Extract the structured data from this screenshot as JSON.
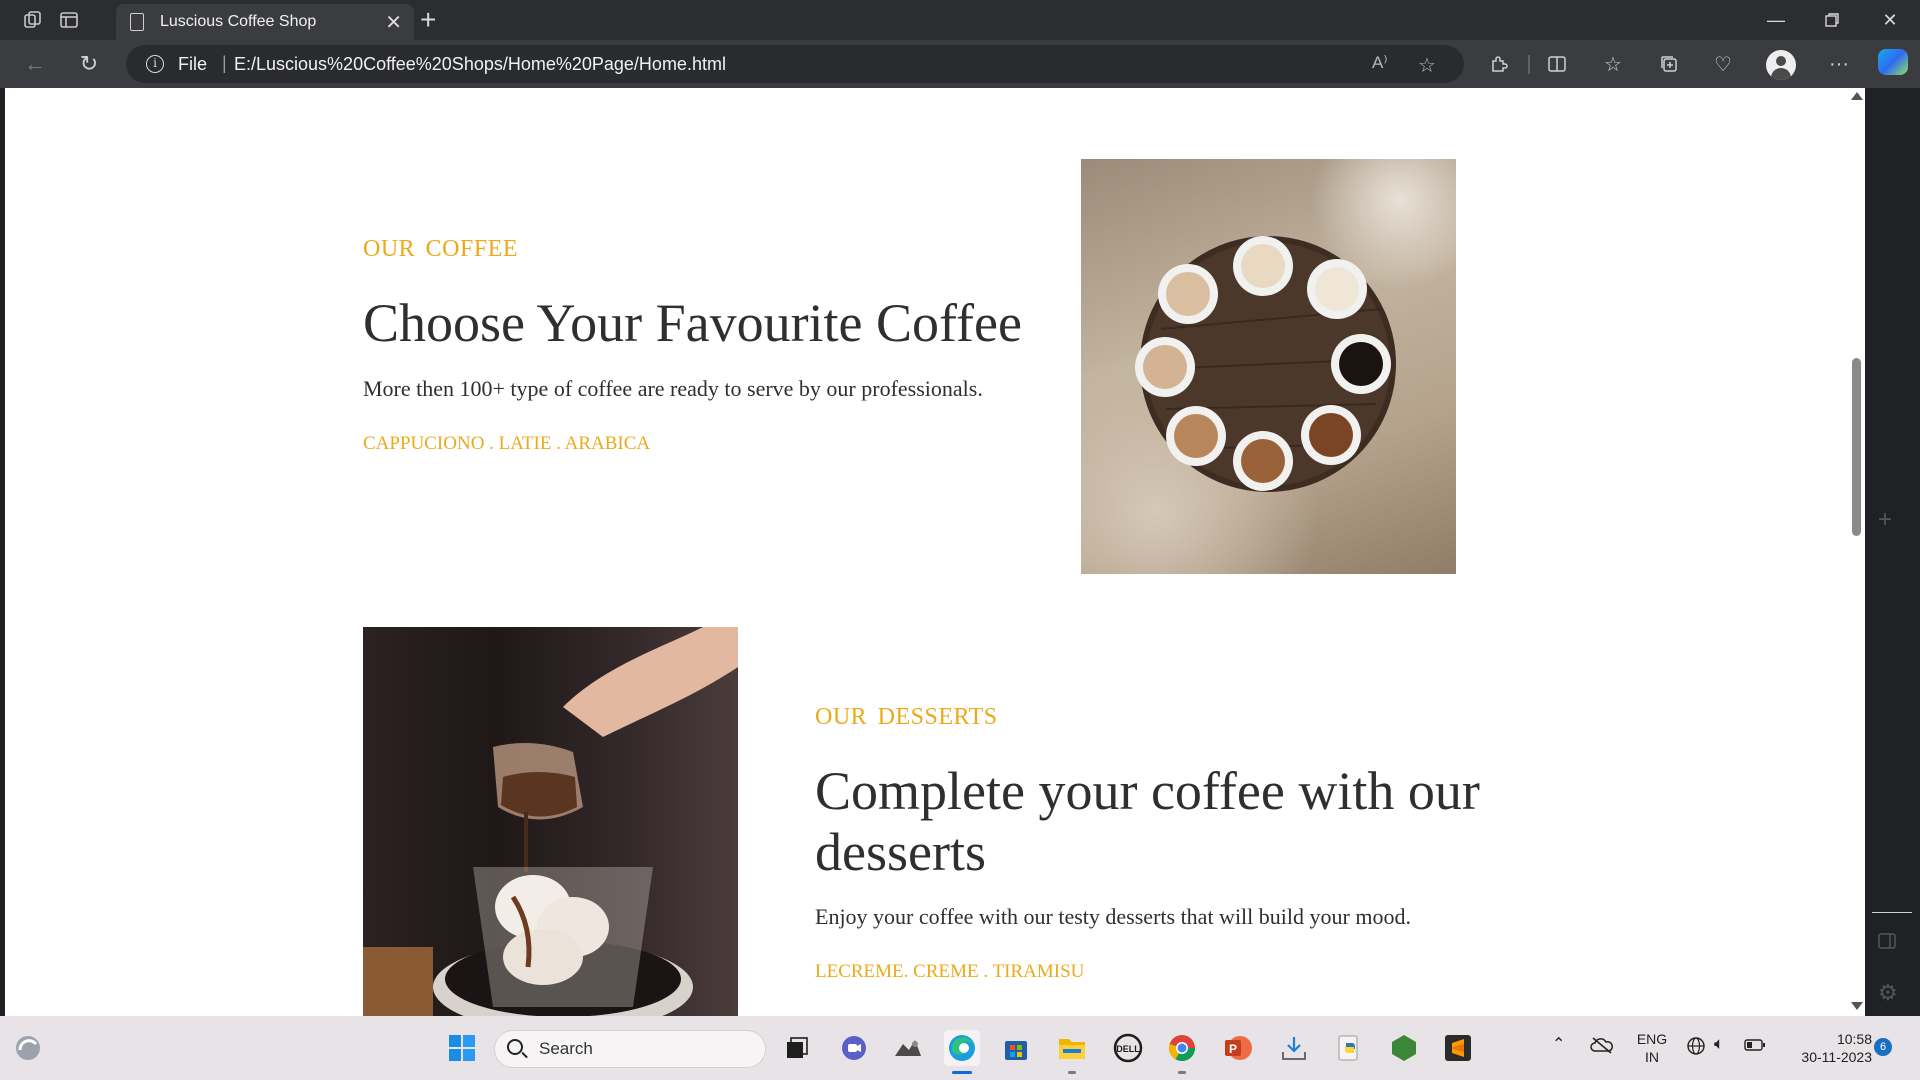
{
  "browser": {
    "tab_title": "Luscious Coffee Shop",
    "address_scheme": "File",
    "address_url": "E:/Luscious%20Coffee%20Shops/Home%20Page/Home.html",
    "read_aloud": "A⁾"
  },
  "sections": [
    {
      "eyebrow": "OUR  COFFEE",
      "heading": "Choose Your Favourite Coffee",
      "text": "More then 100+ type of coffee are ready to serve by our professionals.",
      "tags": "CAPPUCIONO . LATIE . ARABICA"
    },
    {
      "eyebrow": "OUR  DESSERTS",
      "heading": "Complete your coffee with our desserts",
      "text": "Enjoy your coffee with our testy desserts that will build your mood.",
      "tags": "LECREME. CREME . TIRAMISU"
    }
  ],
  "taskbar": {
    "search_label": "Search",
    "lang_top": "ENG",
    "lang_bottom": "IN",
    "time": "10:58",
    "date": "30-11-2023",
    "notifications": "6"
  },
  "colors": {
    "accent": "#ecaa1b",
    "text": "#2f2f2f"
  }
}
